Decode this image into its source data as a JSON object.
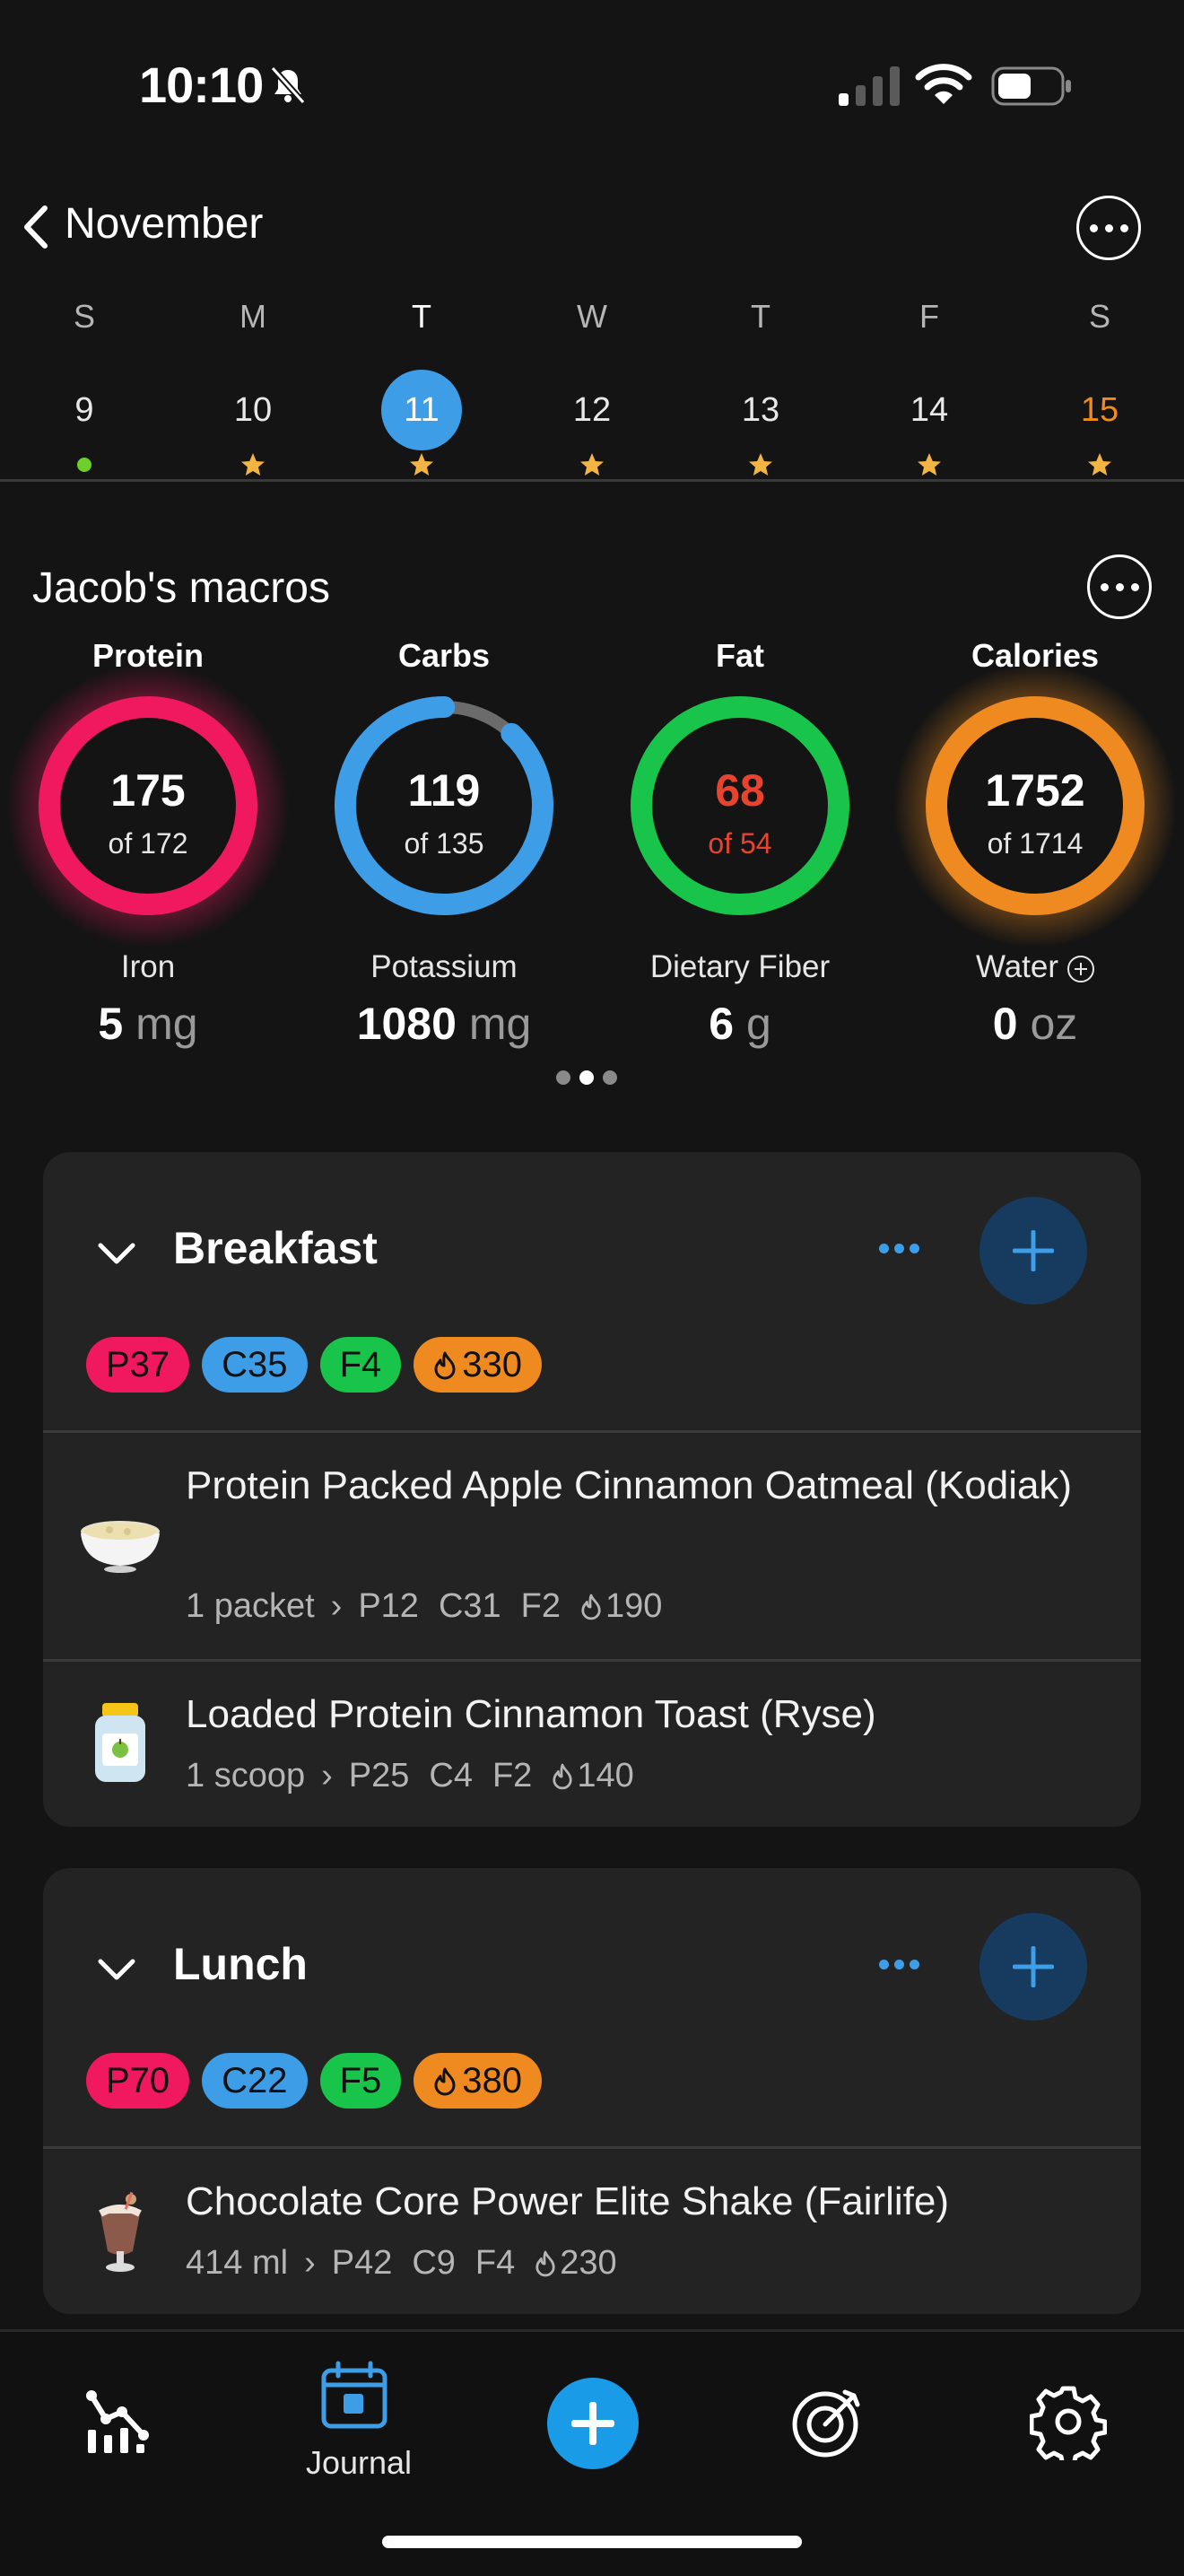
{
  "status_bar": {
    "time": "10:10"
  },
  "calendar": {
    "month": "November",
    "days": [
      {
        "dow": "S",
        "num": "9",
        "mark": "dot"
      },
      {
        "dow": "M",
        "num": "10",
        "mark": "star"
      },
      {
        "dow": "T",
        "num": "11",
        "mark": "star",
        "selected": true
      },
      {
        "dow": "W",
        "num": "12",
        "mark": "star"
      },
      {
        "dow": "T",
        "num": "13",
        "mark": "star"
      },
      {
        "dow": "F",
        "num": "14",
        "mark": "star"
      },
      {
        "dow": "S",
        "num": "15",
        "mark": "star"
      }
    ]
  },
  "macros": {
    "title": "Jacob's macros",
    "rings": [
      {
        "label": "Protein",
        "value": "175",
        "target": "of 172",
        "progress": 1.02,
        "color": "#f0195f"
      },
      {
        "label": "Carbs",
        "value": "119",
        "target": "of 135",
        "progress": 0.88,
        "color": "#3d9de6"
      },
      {
        "label": "Fat",
        "value": "68",
        "target": "of 54",
        "progress": 1.26,
        "color": "#19c44a"
      },
      {
        "label": "Calories",
        "value": "1752",
        "target": "of 1714",
        "progress": 1.02,
        "color": "#ee8a1f"
      }
    ],
    "micros": [
      {
        "label": "Iron",
        "value": "5",
        "unit": "mg"
      },
      {
        "label": "Potassium",
        "value": "1080",
        "unit": "mg"
      },
      {
        "label": "Dietary Fiber",
        "value": "6",
        "unit": "g"
      },
      {
        "label": "Water",
        "value": "0",
        "unit": "oz"
      }
    ]
  },
  "meals": [
    {
      "name": "Breakfast",
      "pills": {
        "p": "P37",
        "c": "C35",
        "f": "F4",
        "k": "330"
      },
      "entries": [
        {
          "name": "Protein Packed Apple Cinnamon Oatmeal (Kodiak)",
          "serving": "1 packet",
          "p": "P12",
          "c": "C31",
          "f": "F2",
          "k": "190",
          "icon": "oatmeal-bowl-icon"
        },
        {
          "name": "Loaded Protein Cinnamon Toast (Ryse)",
          "serving": "1 scoop",
          "p": "P25",
          "c": "C4",
          "f": "F2",
          "k": "140",
          "icon": "protein-jar-icon"
        }
      ]
    },
    {
      "name": "Lunch",
      "pills": {
        "p": "P70",
        "c": "C22",
        "f": "F5",
        "k": "380"
      },
      "entries": [
        {
          "name": "Chocolate Core Power Elite Shake (Fairlife)",
          "serving": "414 ml",
          "p": "P42",
          "c": "C9",
          "f": "F4",
          "k": "230",
          "icon": "shake-glass-icon"
        }
      ]
    }
  ],
  "tabbar": {
    "journal_label": "Journal"
  },
  "colors": {
    "accent": "#3d9de6",
    "protein": "#f0195f",
    "carbs": "#3d9de6",
    "fat": "#19c44a",
    "calories": "#ee8a1f",
    "over": "#e8432f"
  }
}
